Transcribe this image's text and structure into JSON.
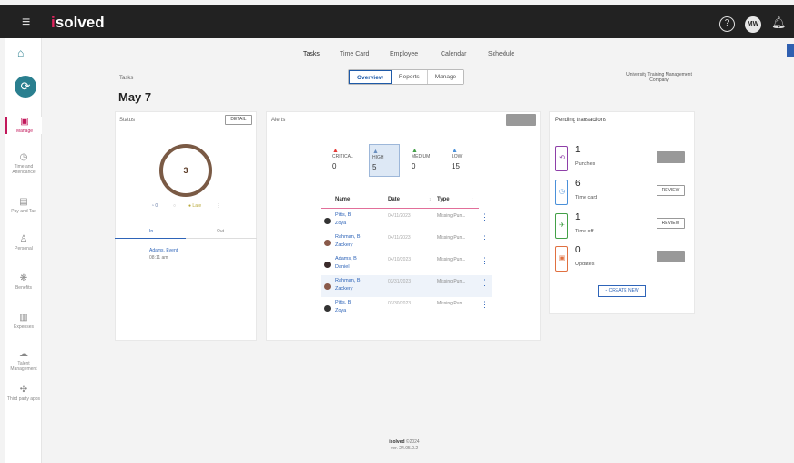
{
  "header": {
    "brand_prefix": "i",
    "brand": "solved",
    "help": "?",
    "user_initials": "MW"
  },
  "sidebar": {
    "items": [
      {
        "label": "Manage",
        "icon": "briefcase-icon"
      },
      {
        "label": "Time and Attendance",
        "icon": "clock-icon"
      },
      {
        "label": "Pay and Tax",
        "icon": "money-icon"
      },
      {
        "label": "Personal",
        "icon": "person-icon"
      },
      {
        "label": "Benefits",
        "icon": "benefits-icon"
      },
      {
        "label": "Expenses",
        "icon": "receipt-icon"
      },
      {
        "label": "Talent Management",
        "icon": "cloud-icon"
      },
      {
        "label": "Third party apps",
        "icon": "puzzle-icon"
      }
    ]
  },
  "tabs": [
    "Tasks",
    "Time Card",
    "Employee",
    "Calendar",
    "Schedule"
  ],
  "breadcrumb": "Tasks",
  "date_title": "May 7",
  "views": [
    "Overview",
    "Reports",
    "Manage"
  ],
  "company": "University Training Management Company",
  "status": {
    "title": "Status",
    "detail_btn": "DETAIL",
    "count": "3",
    "legend_a": "0",
    "legend_b": "Late",
    "tab_in": "In",
    "tab_out": "Out",
    "entry_name": "Adams, Event",
    "entry_time": "08:11 am"
  },
  "alerts": {
    "title": "Alerts",
    "tiers": [
      {
        "label": "CRITICAL",
        "count": "0",
        "color": "#e53935"
      },
      {
        "label": "HIGH",
        "count": "5",
        "color": "#6a8fc0"
      },
      {
        "label": "MEDIUM",
        "count": "0",
        "color": "#43a047"
      },
      {
        "label": "LOW",
        "count": "15",
        "color": "#4a90d9"
      }
    ],
    "columns": [
      "Name",
      "Date",
      "Type"
    ],
    "rows": [
      {
        "name_l1": "Pitts, B",
        "name_l2": "Zoya",
        "date": "04/11/2023",
        "type": "Missing Pun..."
      },
      {
        "name_l1": "Rahman, B",
        "name_l2": "Zackery",
        "date": "04/11/2023",
        "type": "Missing Pun..."
      },
      {
        "name_l1": "Adams, B",
        "name_l2": "Daniel",
        "date": "04/10/2023",
        "type": "Missing Pun..."
      },
      {
        "name_l1": "Rahman, B",
        "name_l2": "Zackery",
        "date": "03/31/2023",
        "type": "Missing Pun..."
      },
      {
        "name_l1": "Pitts, B",
        "name_l2": "Zoya",
        "date": "03/30/2023",
        "type": "Missing Pun..."
      }
    ]
  },
  "pending": {
    "title": "Pending transactions",
    "items": [
      {
        "count": "1",
        "label": "Punches",
        "action": "",
        "color": "#8e3fa8"
      },
      {
        "count": "6",
        "label": "Time card",
        "action": "REVIEW",
        "color": "#4a90d9"
      },
      {
        "count": "1",
        "label": "Time off",
        "action": "REVIEW",
        "color": "#43a047"
      },
      {
        "count": "0",
        "label": "Updates",
        "action": "",
        "color": "#e07040"
      }
    ],
    "create_new": "+ CREATE NEW"
  },
  "footer": {
    "brand": "isolved",
    "copyright": "©2024",
    "version": "ver. 24.05.0.2"
  }
}
